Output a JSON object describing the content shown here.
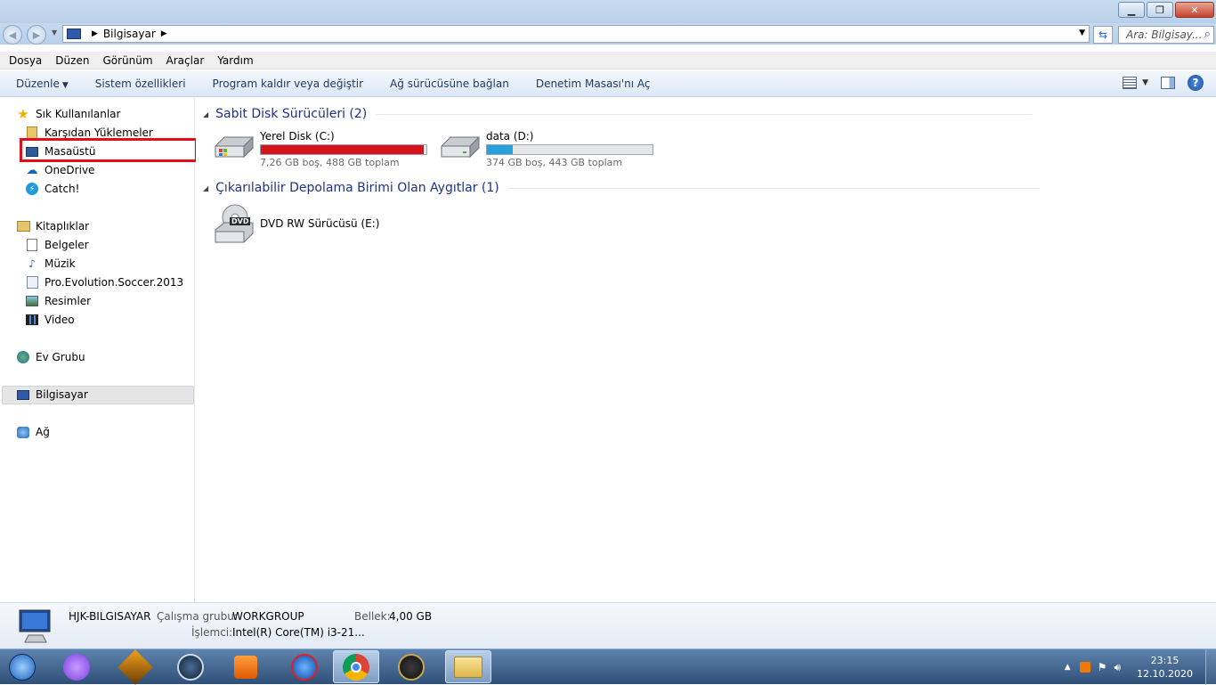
{
  "window": {
    "minimize": "▁",
    "maximize": "❐",
    "close": "✕"
  },
  "address": {
    "location": "Bilgisayar",
    "search_placeholder": "Ara: Bilgisay..."
  },
  "menu": [
    "Dosya",
    "Düzen",
    "Görünüm",
    "Araçlar",
    "Yardım"
  ],
  "commands": {
    "organize": "Düzenle",
    "system_properties": "Sistem özellikleri",
    "uninstall": "Program kaldır veya değiştir",
    "map_drive": "Ağ sürücüsüne bağlan",
    "control_panel": "Denetim Masası'nı Aç",
    "help": "?"
  },
  "sidebar": {
    "favorites": "Sık Kullanılanlar",
    "favorites_items": [
      "Karşıdan Yüklemeler",
      "Masaüstü",
      "OneDrive",
      "Catch!"
    ],
    "libraries": "Kitaplıklar",
    "library_items": [
      "Belgeler",
      "Müzik",
      "Pro.Evolution.Soccer.2013",
      "Resimler",
      "Video"
    ],
    "homegroup": "Ev Grubu",
    "computer": "Bilgisayar",
    "network": "Ağ"
  },
  "main": {
    "hdd_group": "Sabit Disk Sürücüleri (2)",
    "removable_group": "Çıkarılabilir Depolama Birimi Olan Aygıtlar (1)",
    "drives": [
      {
        "name": "Yerel Disk (C:)",
        "info": "7,26 GB boş, 488 GB toplam",
        "used_fraction": 0.985,
        "color": "#d4131b"
      },
      {
        "name": "data (D:)",
        "info": "374 GB boş, 443 GB toplam",
        "used_fraction": 0.156,
        "color": "#26a0da"
      }
    ],
    "dvd": {
      "name": "DVD RW Sürücüsü (E:)",
      "badge": "DVD"
    }
  },
  "details": {
    "computer_name": "HJK-BILGISAYAR",
    "workgroup_label": "Çalışma grubu:",
    "workgroup_value": "WORKGROUP",
    "memory_label": "Bellek:",
    "memory_value": "4,00 GB",
    "processor_label": "İşlemci:",
    "processor_value": "Intel(R) Core(TM) i3-21..."
  },
  "taskbar": {
    "clock_time": "23:15",
    "clock_date": "12.10.2020",
    "apps": [
      "start-orb",
      "alice-assistant",
      "winamp",
      "steam",
      "media-player",
      "ccleaner",
      "chrome",
      "league-of-legends",
      "explorer"
    ]
  }
}
